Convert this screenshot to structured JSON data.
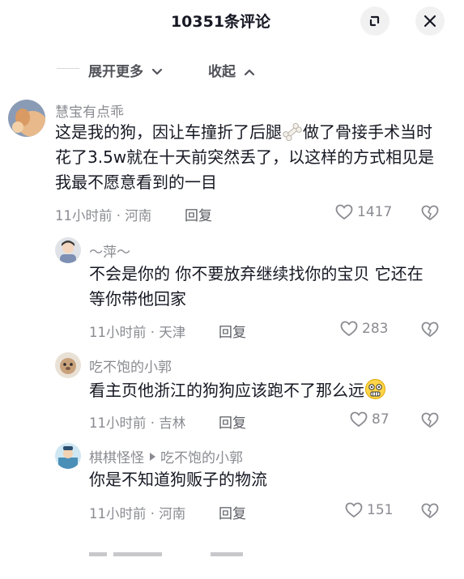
{
  "header": {
    "title": "10351条评论"
  },
  "controls": {
    "expand_label": "展开更多",
    "collapse_label": "收起"
  },
  "comments": [
    {
      "user": "慧宝有点乖",
      "text_before": "这是我的狗，因让车撞折了后腿",
      "text_after": "做了骨接手术当时花了3.5w就在十天前突然丢了，以这样的方式相见是我最不愿意看到的一目",
      "meta": "11小时前 · 河南",
      "reply": "回复",
      "likes": "1417"
    },
    {
      "user": "～萍～",
      "text": "不会是你的 你不要放弃继续找你的宝贝 它还在等你带他回家",
      "meta": "11小时前 · 天津",
      "reply": "回复",
      "likes": "283"
    },
    {
      "user": "吃不饱的小郭",
      "text": "看主页他浙江的狗狗应该跑不了那么远",
      "meta": "11小时前 · 吉林",
      "reply": "回复",
      "likes": "87"
    },
    {
      "user": "棋棋怪怪",
      "reply_to": "吃不饱的小郭",
      "text": "你是不知道狗贩子的物流",
      "meta": "11小时前 · 河南",
      "reply": "回复",
      "likes": "151"
    }
  ],
  "colors": {
    "primary_text": "#161823",
    "secondary_text": "#8a8b91",
    "button_bg": "#f1f1f2"
  },
  "icons": [
    "minimize-icon",
    "close-icon",
    "chevron-down-icon",
    "chevron-up-icon",
    "heart-icon",
    "dislike-icon",
    "bone-emoji",
    "surprised-emoji"
  ]
}
